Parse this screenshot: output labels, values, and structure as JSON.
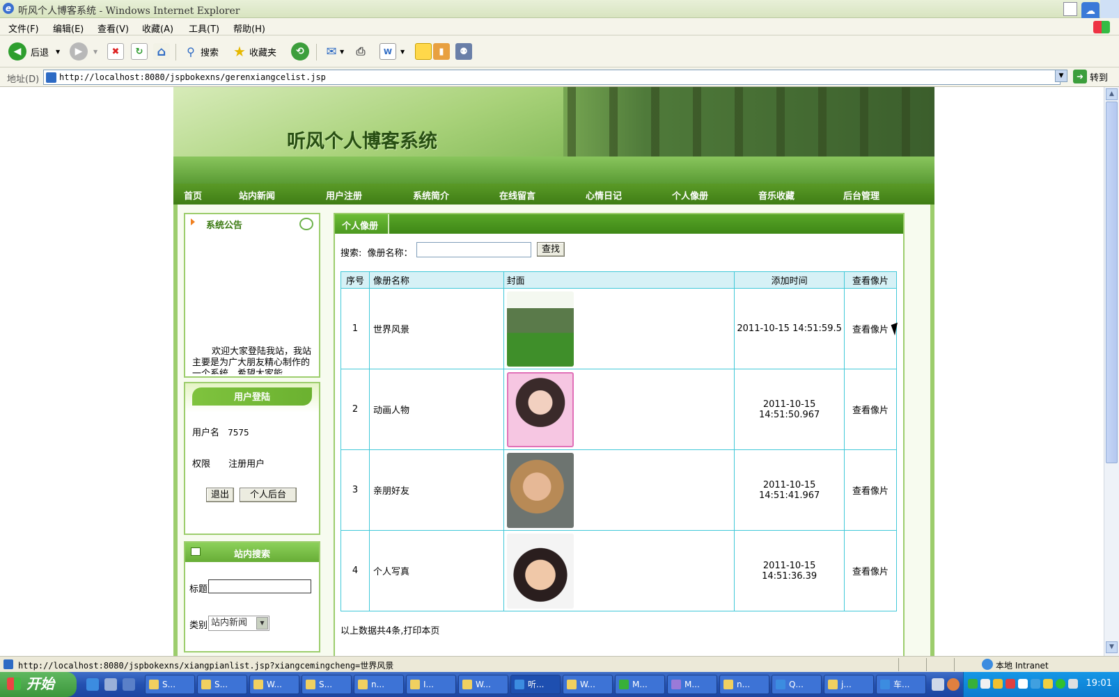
{
  "window": {
    "title": "听风个人博客系统 - Windows Internet Explorer"
  },
  "menu": [
    "文件(F)",
    "编辑(E)",
    "查看(V)",
    "收藏(A)",
    "工具(T)",
    "帮助(H)"
  ],
  "toolbar": {
    "back_label": "后退",
    "search_label": "搜索",
    "favorites_label": "收藏夹"
  },
  "address": {
    "label": "地址(D)",
    "url": "http://localhost:8080/jspbokexns/gerenxiangcelist.jsp",
    "go_label": "转到"
  },
  "site": {
    "title": "听风个人博客系统",
    "nav": [
      "首页",
      "站内新闻",
      "用户注册",
      "系统简介",
      "在线留言",
      "心情日记",
      "个人像册",
      "音乐收藏",
      "后台管理"
    ]
  },
  "notice": {
    "title": "系统公告",
    "text": "欢迎大家登陆我站，我站主要是为广大朋友精心制作的一个系统，希望大家能"
  },
  "login": {
    "title": "用户登陆",
    "username_label": "用户名",
    "username_value": "7575",
    "role_label": "权限",
    "role_value": "注册用户",
    "logout_button": "退出",
    "admin_button": "个人后台"
  },
  "site_search": {
    "title": "站内搜索",
    "title_label": "标题",
    "title_value": "",
    "category_label": "类别",
    "category_value": "站内新闻"
  },
  "main": {
    "title": "个人像册",
    "search_label": "搜索:",
    "album_name_label": "像册名称：",
    "album_name_value": "",
    "search_button": "查找",
    "columns": [
      "序号",
      "像册名称",
      "封面",
      "添加时间",
      "查看像片"
    ],
    "rows": [
      {
        "idx": "1",
        "name": "世界风景",
        "time": "2011-10-15 14:51:59.5",
        "action": "查看像片"
      },
      {
        "idx": "2",
        "name": "动画人物",
        "time": "2011-10-15 14:51:50.967",
        "action": "查看像片"
      },
      {
        "idx": "3",
        "name": "亲朋好友",
        "time": "2011-10-15 14:51:41.967",
        "action": "查看像片"
      },
      {
        "idx": "4",
        "name": "个人写真",
        "time": "2011-10-15 14:51:36.39",
        "action": "查看像片"
      }
    ],
    "footer": "以上数据共4条,打印本页"
  },
  "status": {
    "url": "http://localhost:8080/jspbokexns/xiangpianlist.jsp?xiangcemingcheng=世界风景",
    "zone": "本地 Intranet"
  },
  "taskbar": {
    "start_label": "开始",
    "tasks": [
      "S...",
      "S...",
      "W...",
      "S...",
      "n...",
      "I...",
      "W...",
      "听...",
      "W...",
      "M...",
      "M...",
      "n...",
      "Q...",
      "j...",
      "车..."
    ],
    "clock": "19:01"
  }
}
